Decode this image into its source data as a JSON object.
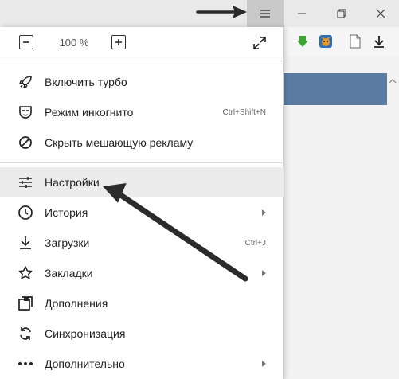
{
  "titlebar": {
    "menu_icon": "hamburger-icon",
    "minimize_icon": "minimize-icon",
    "restore_icon": "restore-icon",
    "close_icon": "close-icon"
  },
  "toolbar": {
    "icons": [
      "download-extension-icon",
      "rabbit-extension-icon",
      "page-icon",
      "downloads-icon"
    ]
  },
  "zoom": {
    "value": "100 %",
    "minus_icon": "minus-icon",
    "plus_icon": "plus-icon",
    "fullscreen_icon": "fullscreen-icon"
  },
  "menu": {
    "items": [
      {
        "label": "Включить турбо",
        "icon": "rocket-icon",
        "shortcut": "",
        "submenu": false
      },
      {
        "label": "Режим инкогнито",
        "icon": "incognito-mask-icon",
        "shortcut": "Ctrl+Shift+N",
        "submenu": false
      },
      {
        "label": "Скрыть мешающую рекламу",
        "icon": "block-icon",
        "shortcut": "",
        "submenu": false
      },
      {
        "label": "Настройки",
        "icon": "settings-sliders-icon",
        "shortcut": "",
        "submenu": false
      },
      {
        "label": "История",
        "icon": "clock-icon",
        "shortcut": "",
        "submenu": true
      },
      {
        "label": "Загрузки",
        "icon": "download-icon",
        "shortcut": "Ctrl+J",
        "submenu": false
      },
      {
        "label": "Закладки",
        "icon": "star-icon",
        "shortcut": "",
        "submenu": true
      },
      {
        "label": "Дополнения",
        "icon": "extensions-icon",
        "shortcut": "",
        "submenu": false
      },
      {
        "label": "Синхронизация",
        "icon": "sync-icon",
        "shortcut": "",
        "submenu": false
      },
      {
        "label": "Дополнительно",
        "icon": "more-dots-icon",
        "shortcut": "",
        "submenu": true
      }
    ]
  },
  "colors": {
    "titlebar_bg": "#e9e9e9",
    "menu_button_active": "#c9c9c9",
    "hover_row": "#ececec",
    "blue_band": "#5b7ba3",
    "arrow": "#2b2b2b"
  }
}
